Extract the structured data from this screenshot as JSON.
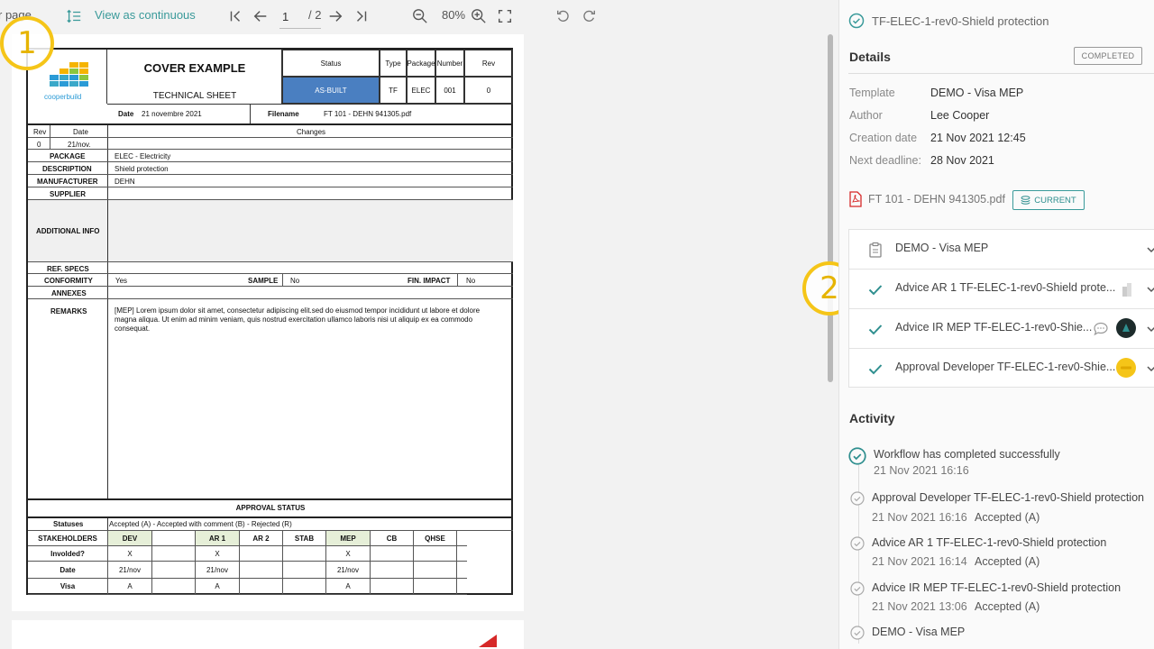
{
  "toolbar": {
    "per_page": "r page",
    "view_mode": "View as continuous",
    "page_current": "1",
    "page_total": "/ 2",
    "zoom": "80%"
  },
  "sheet": {
    "brand": "cooperbuild",
    "title": "COVER EXAMPLE",
    "subtitle": "TECHNICAL SHEET",
    "header_cols": [
      "Status",
      "Type",
      "Package",
      "Number",
      "Rev"
    ],
    "header_vals": [
      "AS-BUILT",
      "TF",
      "ELEC",
      "001",
      "0"
    ],
    "date_label": "Date",
    "date_value": "21 novembre 2021",
    "filename_label": "Filename",
    "filename_value": "FT 101 - DEHN 941305.pdf",
    "rev_label": "Rev",
    "date_col": "Date",
    "changes_label": "Changes",
    "rev_value": "0",
    "rev_date": "21/nov.",
    "package_label": "PACKAGE",
    "package_value": "ELEC - Electricity",
    "description_label": "DESCRIPTION",
    "description_value": "Shield protection",
    "manufacturer_label": "MANUFACTURER",
    "manufacturer_value": "DEHN",
    "supplier_label": "SUPPLIER",
    "additional_label": "ADDITIONAL INFO",
    "refspecs_label": "REF. SPECS",
    "conformity_label": "CONFORMITY",
    "conformity_value": "Yes",
    "sample_label": "SAMPLE",
    "sample_value": "No",
    "finimpact_label": "FIN. IMPACT",
    "finimpact_value": "No",
    "annexes_label": "ANNEXES",
    "remarks_label": "REMARKS",
    "remarks_value": "[MEP] Lorem ipsum dolor sit amet, consectetur adipiscing elit.sed do eiusmod tempor incididunt ut labore et dolore magna aliqua. Ut enim ad minim veniam, quis nostrud exercitation ullamco laboris nisi ut aliquip ex ea commodo consequat.",
    "approval_title": "APPROVAL STATUS",
    "statuses_label": "Statuses",
    "statuses_value": "Accepted (A) - Accepted with comment (B) - Rejected (R)",
    "stakeholders_label": "STAKEHOLDERS",
    "stakeholders": [
      "DEV",
      "",
      "AR 1",
      "AR 2",
      "STAB",
      "MEP",
      "CB",
      "QHSE",
      ""
    ],
    "involved_label": "Involded?",
    "involved": [
      "X",
      "",
      "X",
      "",
      "",
      "X",
      "",
      "",
      ""
    ],
    "date_row_label": "Date",
    "dates": [
      "21/nov",
      "",
      "21/nov",
      "",
      "",
      "21/nov",
      "",
      "",
      ""
    ],
    "visa_label": "Visa",
    "visas": [
      "A",
      "",
      "A",
      "",
      "",
      "A",
      "",
      "",
      ""
    ]
  },
  "badges": {
    "one": "1",
    "two": "2"
  },
  "panel": {
    "doc_title": "TF-ELEC-1-rev0-Shield protection",
    "details_title": "Details",
    "status": "COMPLETED",
    "details": [
      {
        "k": "Template",
        "v": "DEMO - Visa MEP"
      },
      {
        "k": "Author",
        "v": "Lee Cooper"
      },
      {
        "k": "Creation date",
        "v": "21 Nov 2021 12:45"
      },
      {
        "k": "Next deadline:",
        "v": "28 Nov 2021"
      }
    ],
    "file_name": "FT 101 - DEHN 941305.pdf",
    "file_tag": "CURRENT",
    "workflow": [
      "DEMO - Visa MEP",
      "Advice AR 1 TF-ELEC-1-rev0-Shield prote...",
      "Advice IR MEP TF-ELEC-1-rev0-Shie...",
      "Approval Developer TF-ELEC-1-rev0-Shie..."
    ],
    "activity_title": "Activity",
    "activity": [
      {
        "title": "Workflow has completed successfully",
        "time": "21 Nov 2021 16:16",
        "status": ""
      },
      {
        "title": "Approval Developer TF-ELEC-1-rev0-Shield protection",
        "time": "21 Nov 2021 16:16",
        "status": "Accepted (A)"
      },
      {
        "title": "Advice AR 1 TF-ELEC-1-rev0-Shield protection",
        "time": "21 Nov 2021 16:14",
        "status": "Accepted (A)"
      },
      {
        "title": "Advice IR MEP TF-ELEC-1-rev0-Shield protection",
        "time": "21 Nov 2021 13:06",
        "status": "Accepted (A)"
      },
      {
        "title": "DEMO - Visa MEP",
        "time": "",
        "status": ""
      }
    ]
  },
  "colors": {
    "accent": "#2f8f8f",
    "status_blue": "#4a7fc1",
    "badge": "#f5c518"
  }
}
